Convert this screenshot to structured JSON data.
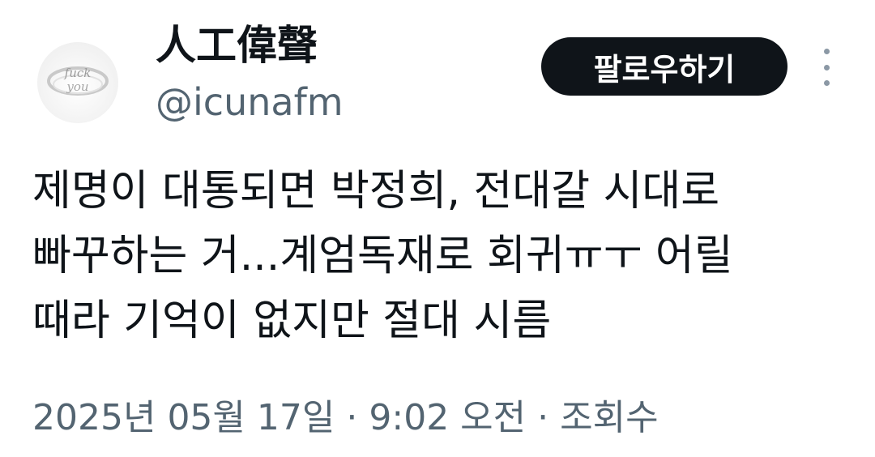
{
  "author": {
    "display_name": "人工偉聲",
    "handle": "@icunafm",
    "avatar_icon": "ring-photo-avatar"
  },
  "actions": {
    "follow_label": "팔로우하기",
    "more_icon": "more-vertical-icon"
  },
  "tweet": {
    "text": "제명이 대통되면 박정희, 전대갈 시대로\n빠꾸하는 거...계엄독재로 회귀ㅠㅜ 어릴\n때라 기억이 없지만 절대 시름"
  },
  "meta": {
    "date": "2025년 05월 17일",
    "separator": "·",
    "time": "9:02 오전",
    "views_label": "조회수"
  },
  "colors": {
    "text_primary": "#0f1419",
    "text_secondary": "#536471",
    "button_bg": "#0f1419",
    "button_text": "#ffffff"
  }
}
